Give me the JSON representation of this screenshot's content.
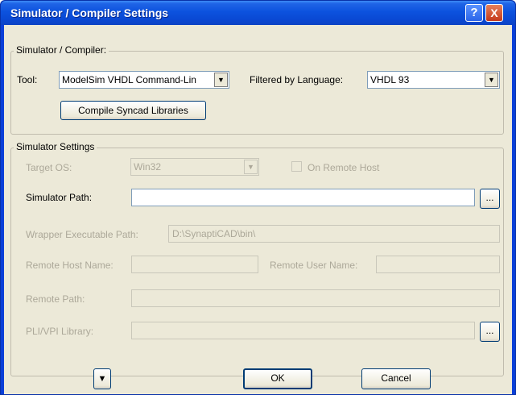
{
  "window": {
    "title": "Simulator / Compiler Settings",
    "help_glyph": "?",
    "close_glyph": "X"
  },
  "sim_compiler": {
    "caption": "Simulator / Compiler:",
    "tool_label": "Tool:",
    "tool_value": "ModelSim VHDL Command-Lin",
    "language_label": "Filtered by Language:",
    "language_value": "VHDL 93",
    "compile_button": "Compile Syncad Libraries"
  },
  "sim_settings": {
    "caption": "Simulator Settings",
    "target_os_label": "Target OS:",
    "target_os_value": "Win32",
    "remote_host_checkbox": "On Remote Host",
    "simulator_path_label": "Simulator Path:",
    "simulator_path_value": "",
    "browse_label": "...",
    "wrapper_label": "Wrapper Executable Path:",
    "wrapper_value": "D:\\SynaptiCAD\\bin\\",
    "remote_host_name_label": "Remote Host Name:",
    "remote_user_name_label": "Remote User Name:",
    "remote_path_label": "Remote Path:",
    "pli_label": "PLI/VPI Library:"
  },
  "footer": {
    "expand_glyph": "▼",
    "ok_label": "OK",
    "cancel_label": "Cancel"
  }
}
